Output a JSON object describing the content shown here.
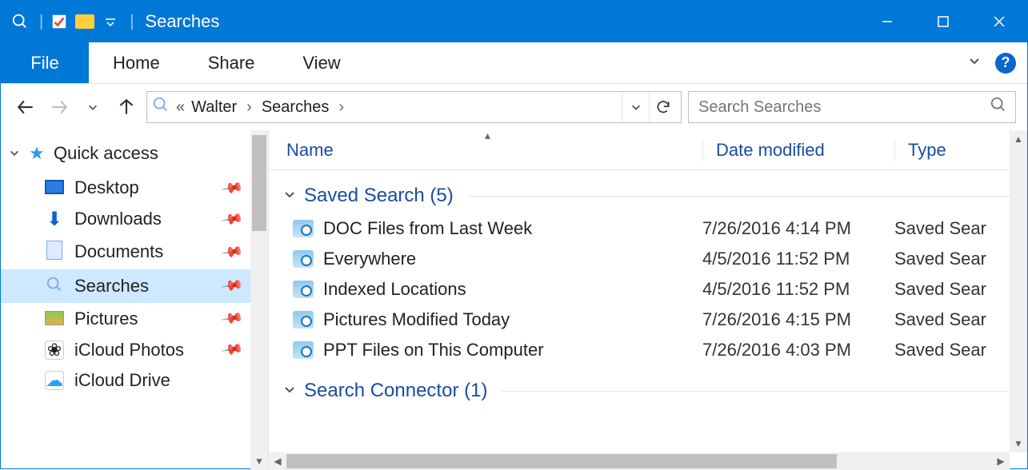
{
  "window": {
    "title": "Searches"
  },
  "ribbon": {
    "file": "File",
    "tabs": [
      "Home",
      "Share",
      "View"
    ]
  },
  "breadcrumb": {
    "prefix": "«",
    "parts": [
      "Walter",
      "Searches"
    ]
  },
  "search": {
    "placeholder": "Search Searches"
  },
  "navpane": {
    "root": "Quick access",
    "items": [
      {
        "label": "Desktop",
        "icon": "desktop",
        "pinned": true
      },
      {
        "label": "Downloads",
        "icon": "download",
        "pinned": true
      },
      {
        "label": "Documents",
        "icon": "document",
        "pinned": true
      },
      {
        "label": "Searches",
        "icon": "search",
        "pinned": true,
        "selected": true
      },
      {
        "label": "Pictures",
        "icon": "pictures",
        "pinned": true
      },
      {
        "label": "iCloud Photos",
        "icon": "icloud-photos",
        "pinned": true
      },
      {
        "label": "iCloud Drive",
        "icon": "icloud-drive"
      }
    ]
  },
  "columns": {
    "name": "Name",
    "date": "Date modified",
    "type": "Type"
  },
  "groups": [
    {
      "title": "Saved Search (5)",
      "rows": [
        {
          "name": "DOC Files from Last Week",
          "date": "7/26/2016 4:14 PM",
          "type": "Saved Sear"
        },
        {
          "name": "Everywhere",
          "date": "4/5/2016 11:52 PM",
          "type": "Saved Sear"
        },
        {
          "name": "Indexed Locations",
          "date": "4/5/2016 11:52 PM",
          "type": "Saved Sear"
        },
        {
          "name": "Pictures Modified Today",
          "date": "7/26/2016 4:15 PM",
          "type": "Saved Sear"
        },
        {
          "name": "PPT Files on This Computer",
          "date": "7/26/2016 4:03 PM",
          "type": "Saved Sear"
        }
      ]
    },
    {
      "title": "Search Connector (1)",
      "rows": []
    }
  ]
}
